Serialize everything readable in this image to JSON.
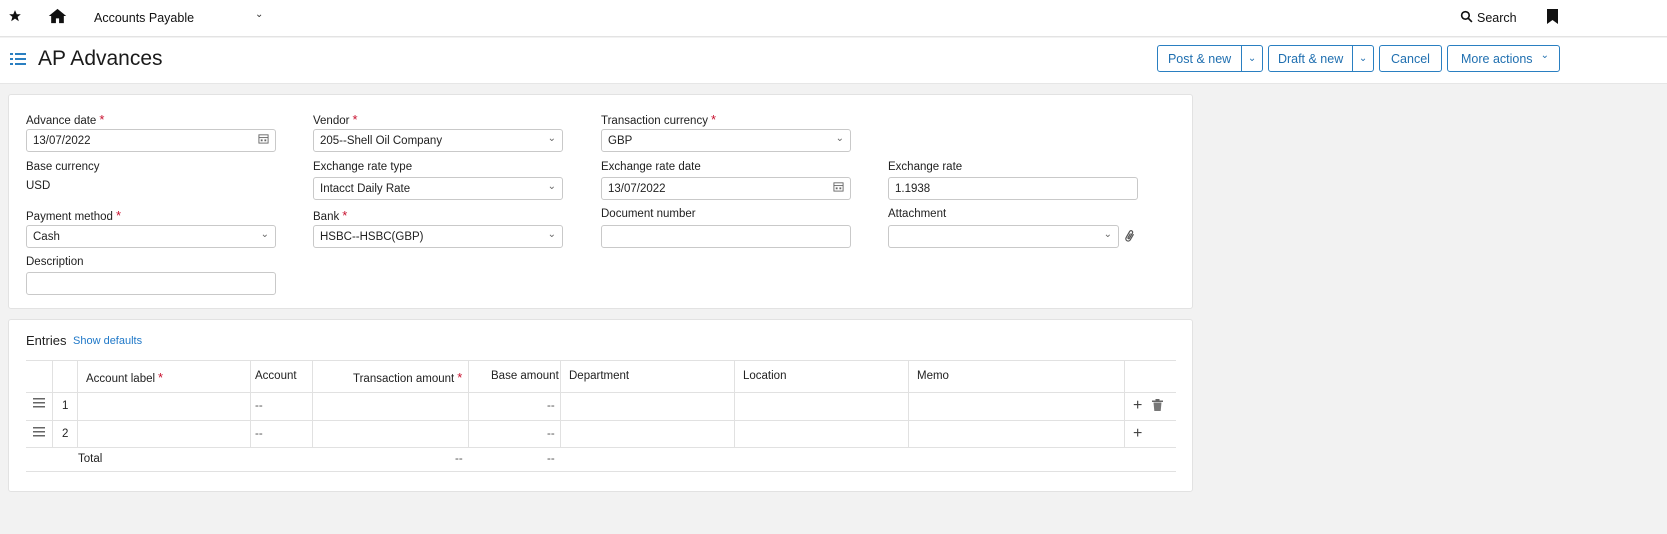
{
  "topbar": {
    "module": "Accounts Payable",
    "search_label": "Search"
  },
  "header": {
    "title": "AP Advances",
    "buttons": {
      "post_new": "Post & new",
      "draft_new": "Draft & new",
      "cancel": "Cancel",
      "more_actions": "More actions"
    }
  },
  "form": {
    "advance_date": {
      "label": "Advance date",
      "value": "13/07/2022"
    },
    "vendor": {
      "label": "Vendor",
      "value": "205--Shell Oil Company"
    },
    "transaction_currency": {
      "label": "Transaction currency",
      "value": "GBP"
    },
    "base_currency": {
      "label": "Base currency",
      "value": "USD"
    },
    "exchange_rate_type": {
      "label": "Exchange rate type",
      "value": "Intacct Daily Rate"
    },
    "exchange_rate_date": {
      "label": "Exchange rate date",
      "value": "13/07/2022"
    },
    "exchange_rate": {
      "label": "Exchange rate",
      "value": "1.1938"
    },
    "payment_method": {
      "label": "Payment method",
      "value": "Cash"
    },
    "bank": {
      "label": "Bank",
      "value": "HSBC--HSBC(GBP)"
    },
    "document_number": {
      "label": "Document number",
      "value": ""
    },
    "attachment": {
      "label": "Attachment",
      "value": ""
    },
    "description": {
      "label": "Description",
      "value": ""
    }
  },
  "entries": {
    "title": "Entries",
    "show_defaults": "Show defaults",
    "columns": {
      "account_label": "Account label",
      "account": "Account",
      "transaction_amount": "Transaction amount",
      "base_amount": "Base amount",
      "department": "Department",
      "location": "Location",
      "memo": "Memo"
    },
    "rows": [
      {
        "num": "1",
        "account": "--",
        "base_amount": "--"
      },
      {
        "num": "2",
        "account": "--",
        "base_amount": "--"
      }
    ],
    "total": {
      "label": "Total",
      "transaction_amount": "--",
      "base_amount": "--"
    }
  }
}
